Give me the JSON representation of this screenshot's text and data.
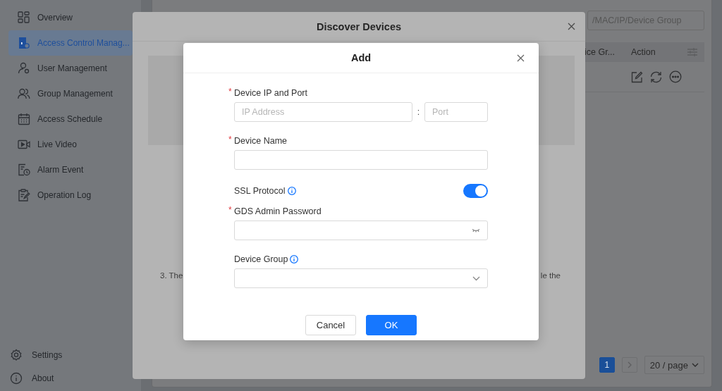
{
  "sidebar": {
    "items": [
      {
        "label": "Overview",
        "selected": false
      },
      {
        "label": "Access Control Manag...",
        "selected": true
      },
      {
        "label": "User Management",
        "selected": false
      },
      {
        "label": "Group Management",
        "selected": false
      },
      {
        "label": "Access Schedule",
        "selected": false
      },
      {
        "label": "Live Video",
        "selected": false
      },
      {
        "label": "Alarm Event",
        "selected": false
      },
      {
        "label": "Operation Log",
        "selected": false
      }
    ],
    "footer_items": [
      {
        "label": "Settings"
      },
      {
        "label": "About"
      }
    ]
  },
  "main": {
    "search": {
      "placeholder": "/MAC/IP/Device Group"
    },
    "table": {
      "columns": [
        "ice Gr...",
        "Action"
      ]
    },
    "pagination": {
      "pages": [
        {
          "label": "1",
          "selected": true
        }
      ],
      "page_size": "20 / page"
    }
  },
  "discover_dialog": {
    "title": "Discover Devices",
    "note_fragments": [
      "3. The",
      "le the"
    ]
  },
  "add_dialog": {
    "title": "Add",
    "fields": [
      {
        "kind": "ip_port",
        "label": "Device IP and Port",
        "required_mark": "*",
        "ip_placeholder": "IP Address",
        "separator": ":",
        "port_placeholder": "Port"
      },
      {
        "kind": "text",
        "label": "Device Name",
        "required_mark": "*"
      },
      {
        "kind": "switch",
        "label": "SSL Protocol",
        "info": true,
        "on": true
      },
      {
        "kind": "password",
        "label": "GDS Admin Password",
        "required_mark": "*"
      },
      {
        "kind": "select",
        "label": "Device Group",
        "info": true
      }
    ],
    "buttons": [
      {
        "label": "Cancel",
        "kind": "secondary"
      },
      {
        "label": "OK",
        "kind": "primary"
      }
    ]
  }
}
